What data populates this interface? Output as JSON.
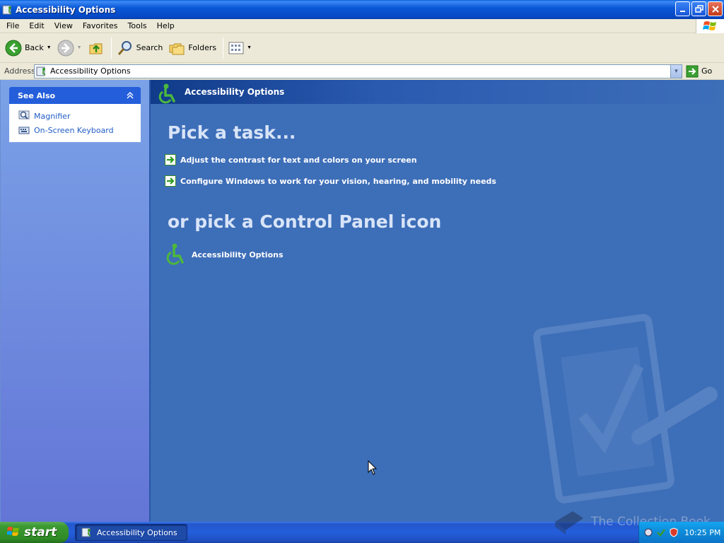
{
  "window": {
    "title": "Accessibility Options"
  },
  "menu": [
    "File",
    "Edit",
    "View",
    "Favorites",
    "Tools",
    "Help"
  ],
  "toolbar": {
    "back_label": "Back",
    "search_label": "Search",
    "folders_label": "Folders"
  },
  "address": {
    "label": "Address",
    "value": "Accessibility Options",
    "go_label": "Go"
  },
  "see_also": {
    "title": "See Also",
    "links": [
      {
        "label": "Magnifier",
        "icon": "magnifier-icon"
      },
      {
        "label": "On-Screen Keyboard",
        "icon": "keyboard-icon"
      }
    ]
  },
  "main": {
    "header_title": "Accessibility Options",
    "pick_task": "Pick a task...",
    "tasks": [
      {
        "label": "Adjust the contrast for text and colors on your screen"
      },
      {
        "label": "Configure Windows to work for your vision, hearing, and mobility needs"
      }
    ],
    "or_pick": "or pick a Control Panel icon",
    "icons": [
      {
        "label": "Accessibility Options",
        "icon": "accessibility-icon"
      }
    ]
  },
  "taskbar": {
    "start_label": "start",
    "task_item": "Accessibility Options",
    "clock": "10:25 PM",
    "brand": "The Collection Book"
  },
  "colors": {
    "main_bg": "#3d6eb8",
    "accent_green": "#3a9a2a",
    "link_blue": "#215dc6"
  }
}
